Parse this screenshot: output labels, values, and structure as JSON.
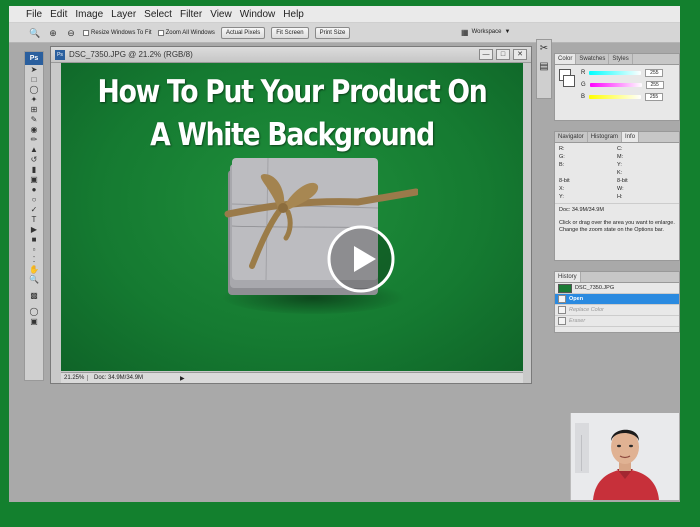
{
  "menu": [
    "File",
    "Edit",
    "Image",
    "Layer",
    "Select",
    "Filter",
    "View",
    "Window",
    "Help"
  ],
  "options_bar": {
    "resize_windows": "Resize Windows To Fit",
    "zoom_all": "Zoom All Windows",
    "actual_pixels": "Actual Pixels",
    "fit_screen": "Fit Screen",
    "print_size": "Print Size",
    "workspace": "Workspace"
  },
  "document": {
    "title": "DSC_7350.JPG @ 21.2% (RGB/8)",
    "headline_line1": "How To Put Your Product On",
    "headline_line2": "A White Background",
    "zoom": "21.25%",
    "doc_size": "Doc: 34.9M/34.9M"
  },
  "color_panel": {
    "tabs": [
      "Color",
      "Swatches",
      "Styles"
    ],
    "r_label": "R",
    "g_label": "G",
    "b_label": "B",
    "r_value": "255",
    "g_value": "255",
    "b_value": "255"
  },
  "info_panel": {
    "tabs": [
      "Navigator",
      "Histogram",
      "Info"
    ],
    "r": "R:",
    "g": "G:",
    "b": "B:",
    "c": "C:",
    "m": "M:",
    "y": "Y:",
    "k": "K:",
    "bit_left": "8-bit",
    "bit_right": "8-bit",
    "x": "X:",
    "yy": "Y:",
    "w": "W:",
    "h": "H:",
    "doc": "Doc: 34.9M/34.9M",
    "note": "Click or drag over the area you want to enlarge. Change the zoom state on the Options bar."
  },
  "history_panel": {
    "tab": "History",
    "snapshot": "DSC_7350.JPG",
    "items": [
      "Open",
      "Replace Color",
      "Eraser"
    ]
  },
  "colors": {
    "background_green": "#13802e",
    "selection_blue": "#2a8ae0"
  }
}
